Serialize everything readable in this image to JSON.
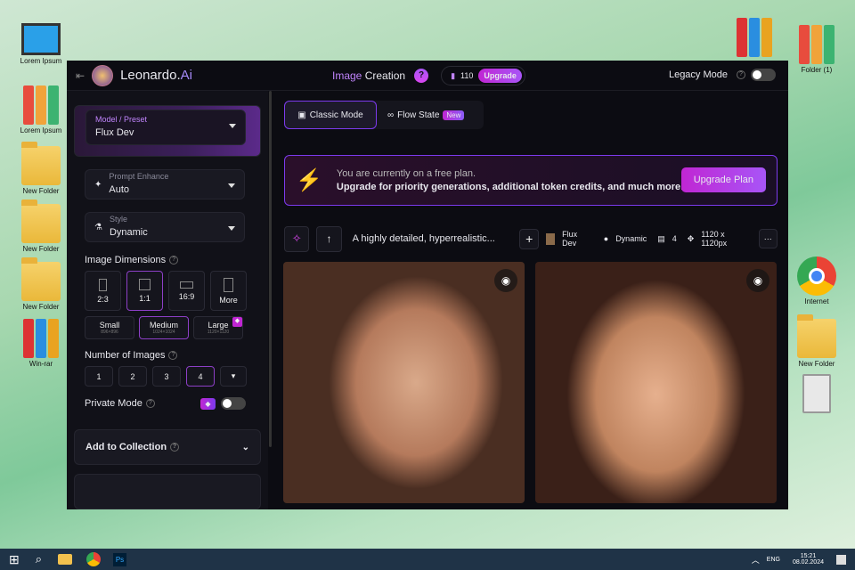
{
  "desktop": {
    "left": [
      "Lorem Ipsum",
      "Lorem Ipsum",
      "New Folder",
      "New Folder",
      "New Folder",
      "Win-rar"
    ],
    "right": [
      "Folder (1)",
      "Internet",
      "New Folder"
    ]
  },
  "header": {
    "brand": "Leonardo.",
    "brand_accent": "Ai",
    "title_accent": "Image",
    "title": " Creation",
    "help": "?",
    "tokens": "110",
    "upgrade": "Upgrade",
    "legacy": "Legacy Mode"
  },
  "sidebar": {
    "model_label": "Model / Preset",
    "model_value": "Flux Dev",
    "enhance_label": "Prompt Enhance",
    "enhance_value": "Auto",
    "style_label": "Style",
    "style_value": "Dynamic",
    "dimensions_title": "Image Dimensions",
    "ratios": [
      "2:3",
      "1:1",
      "16:9",
      "More"
    ],
    "sizes": [
      {
        "name": "Small",
        "dim": "896×896"
      },
      {
        "name": "Medium",
        "dim": "1024×1024"
      },
      {
        "name": "Large",
        "dim": "1120×1120"
      }
    ],
    "num_title": "Number of Images",
    "nums": [
      "1",
      "2",
      "3",
      "4"
    ],
    "private": "Private Mode",
    "collection": "Add to Collection"
  },
  "main": {
    "tab_classic": "Classic Mode",
    "tab_flow": "Flow State",
    "badge_new": "New",
    "banner_line1": "You are currently on a free plan.",
    "banner_line2": "Upgrade for priority generations, additional token credits, and much more!",
    "banner_button": "Upgrade Plan",
    "prompt": "A highly detailed, hyperrealistic...",
    "model": "Flux Dev",
    "style": "Dynamic",
    "count": "4",
    "size": "1120 x 1120px"
  },
  "taskbar": {
    "lang": "ENG",
    "time": "15:21",
    "date": "08.02.2024"
  },
  "colors": {
    "accent": "#a855f7",
    "upgrade": "#d946ef"
  }
}
